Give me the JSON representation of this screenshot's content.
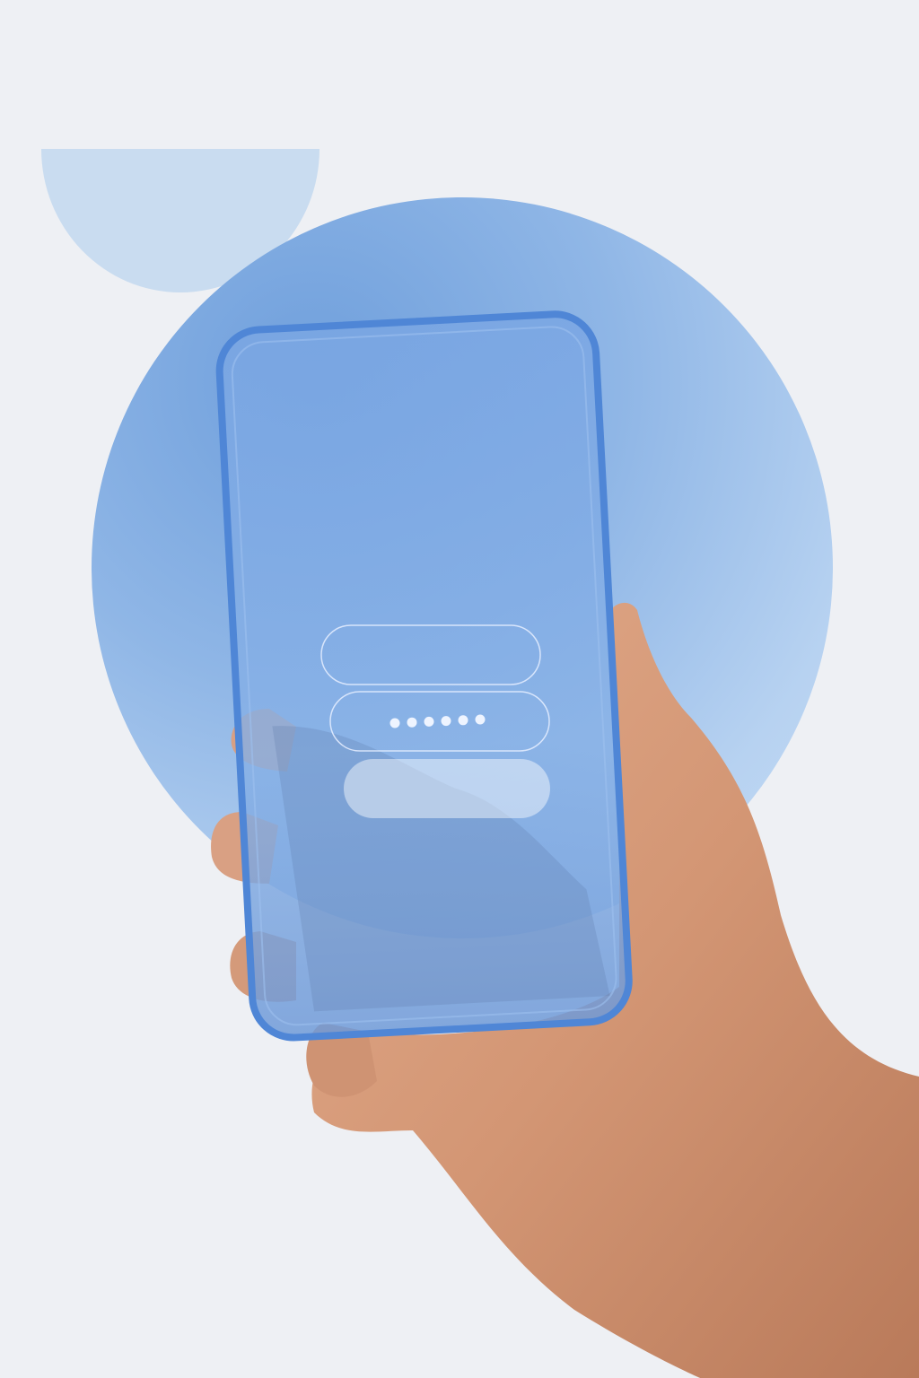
{
  "scene": {
    "background_color": "#eef0f4",
    "accent_light": "#c9dcf0",
    "accent_blue": "#7ea9e0",
    "device_edge": "#4f86d6",
    "skin_tone": "#d49a7a"
  },
  "login_form": {
    "username_field": {
      "value": "",
      "placeholder": ""
    },
    "password_field": {
      "masked_value": "••••••",
      "dot_count": 6
    },
    "submit_button": {
      "label": ""
    }
  }
}
